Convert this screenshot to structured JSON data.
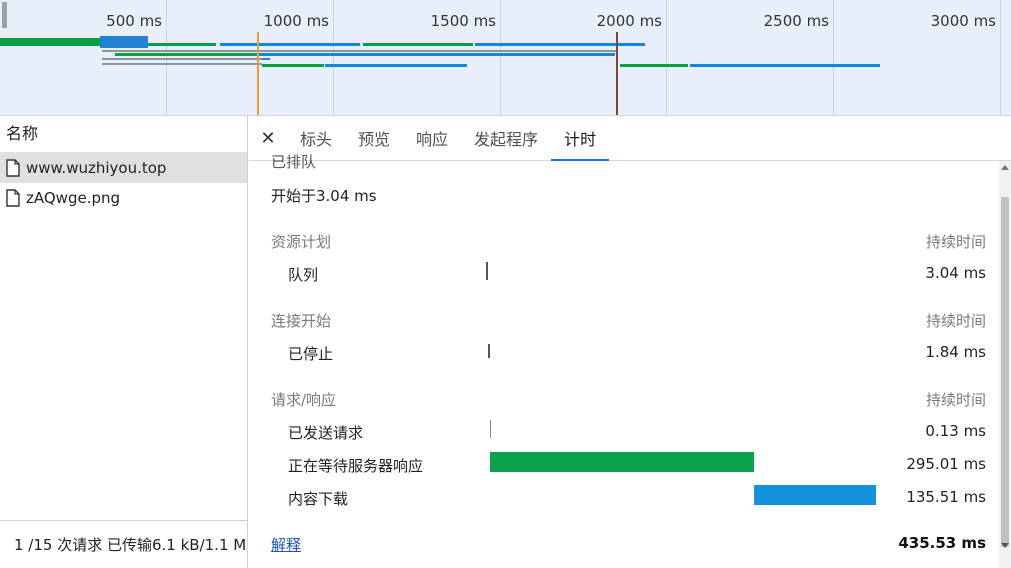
{
  "overview": {
    "ticks": [
      "500 ms",
      "1000 ms",
      "1500 ms",
      "2000 ms",
      "2500 ms",
      "3000 ms"
    ],
    "colors": {
      "waiting": "#0a9e45",
      "download": "#1289d8",
      "blue_block": "#2083d8",
      "gray": "#8d949a",
      "orange_marker": "#f29d2a",
      "brown_marker": "#7a4a3a"
    }
  },
  "request_list": {
    "header": "名称",
    "items": [
      {
        "name": "www.wuzhiyou.top",
        "icon": "document-icon",
        "selected": true
      },
      {
        "name": "zAQwge.png",
        "icon": "document-icon",
        "selected": false
      }
    ],
    "status": "1 /15 次请求  已传输6.1 kB/1.1 M"
  },
  "tabs": {
    "close_icon": "close-icon",
    "items": [
      "标头",
      "预览",
      "响应",
      "发起程序",
      "计时"
    ],
    "active": "计时"
  },
  "timing": {
    "clipped_heading": "已排队",
    "started_at": "开始于3.04 ms",
    "duration_label": "持续时间",
    "sections": [
      {
        "title": "资源计划",
        "items": [
          {
            "label": "队列",
            "value": "3.04 ms"
          }
        ]
      },
      {
        "title": "连接开始",
        "items": [
          {
            "label": "已停止",
            "value": "1.84 ms"
          }
        ]
      },
      {
        "title": "请求/响应",
        "items": [
          {
            "label": "已发送请求",
            "value": "0.13 ms"
          },
          {
            "label": "正在等待服务器响应",
            "value": "295.01 ms",
            "color": "#0aa24a"
          },
          {
            "label": "内容下载",
            "value": "135.51 ms",
            "color": "#1493dc"
          }
        ]
      }
    ],
    "explain_link": "解释",
    "total": "435.53 ms"
  }
}
